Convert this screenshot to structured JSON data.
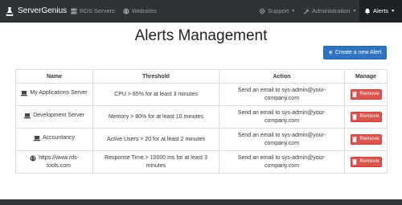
{
  "navbar": {
    "brand": "ServerGenius",
    "items": [
      {
        "label": "RDS Servers",
        "icon": "server-icon"
      },
      {
        "label": "Websites",
        "icon": "globe-icon"
      }
    ],
    "right_items": [
      {
        "label": "Support",
        "icon": "gear-icon"
      },
      {
        "label": "Administration",
        "icon": "wrench-icon"
      },
      {
        "label": "Alerts",
        "icon": "bell-icon",
        "active": true
      }
    ]
  },
  "page": {
    "title": "Alerts Management",
    "create_button": "Create a new Alert"
  },
  "table": {
    "headers": [
      "Name",
      "Threshold",
      "Action",
      "Manage"
    ],
    "remove_label": "Remove",
    "rows": [
      {
        "name": "My Applications Server",
        "icon": "laptop-icon",
        "threshold": "CPU > 85% for at least 3 minutes",
        "action_line1": "Send an email to sys-admin@your-",
        "action_line2": "company.com"
      },
      {
        "name": "Development Server",
        "icon": "laptop-icon",
        "threshold": "Memory > 80% for at least 10 minutes",
        "action_line1": "Send an email to sys-admin@your-",
        "action_line2": "company.com"
      },
      {
        "name": "Accountancy",
        "icon": "laptop-icon",
        "threshold": "Active Users > 20 for at least 2 minutes",
        "action_line1": "Send an email to sys-admin@your-",
        "action_line2": "company.com"
      },
      {
        "name_line1": "https://www.rds-",
        "name_line2": "tools.com",
        "icon": "globe-icon",
        "threshold_line1": "Response Time > 10000 ms for at least 3",
        "threshold_line2": "minutes",
        "action_line1": "Send an email to sys-admin@your-",
        "action_line2": "company.com"
      }
    ]
  },
  "colors": {
    "navbar": "#2e3338",
    "primary": "#2f74c0",
    "danger": "#d9534f"
  }
}
